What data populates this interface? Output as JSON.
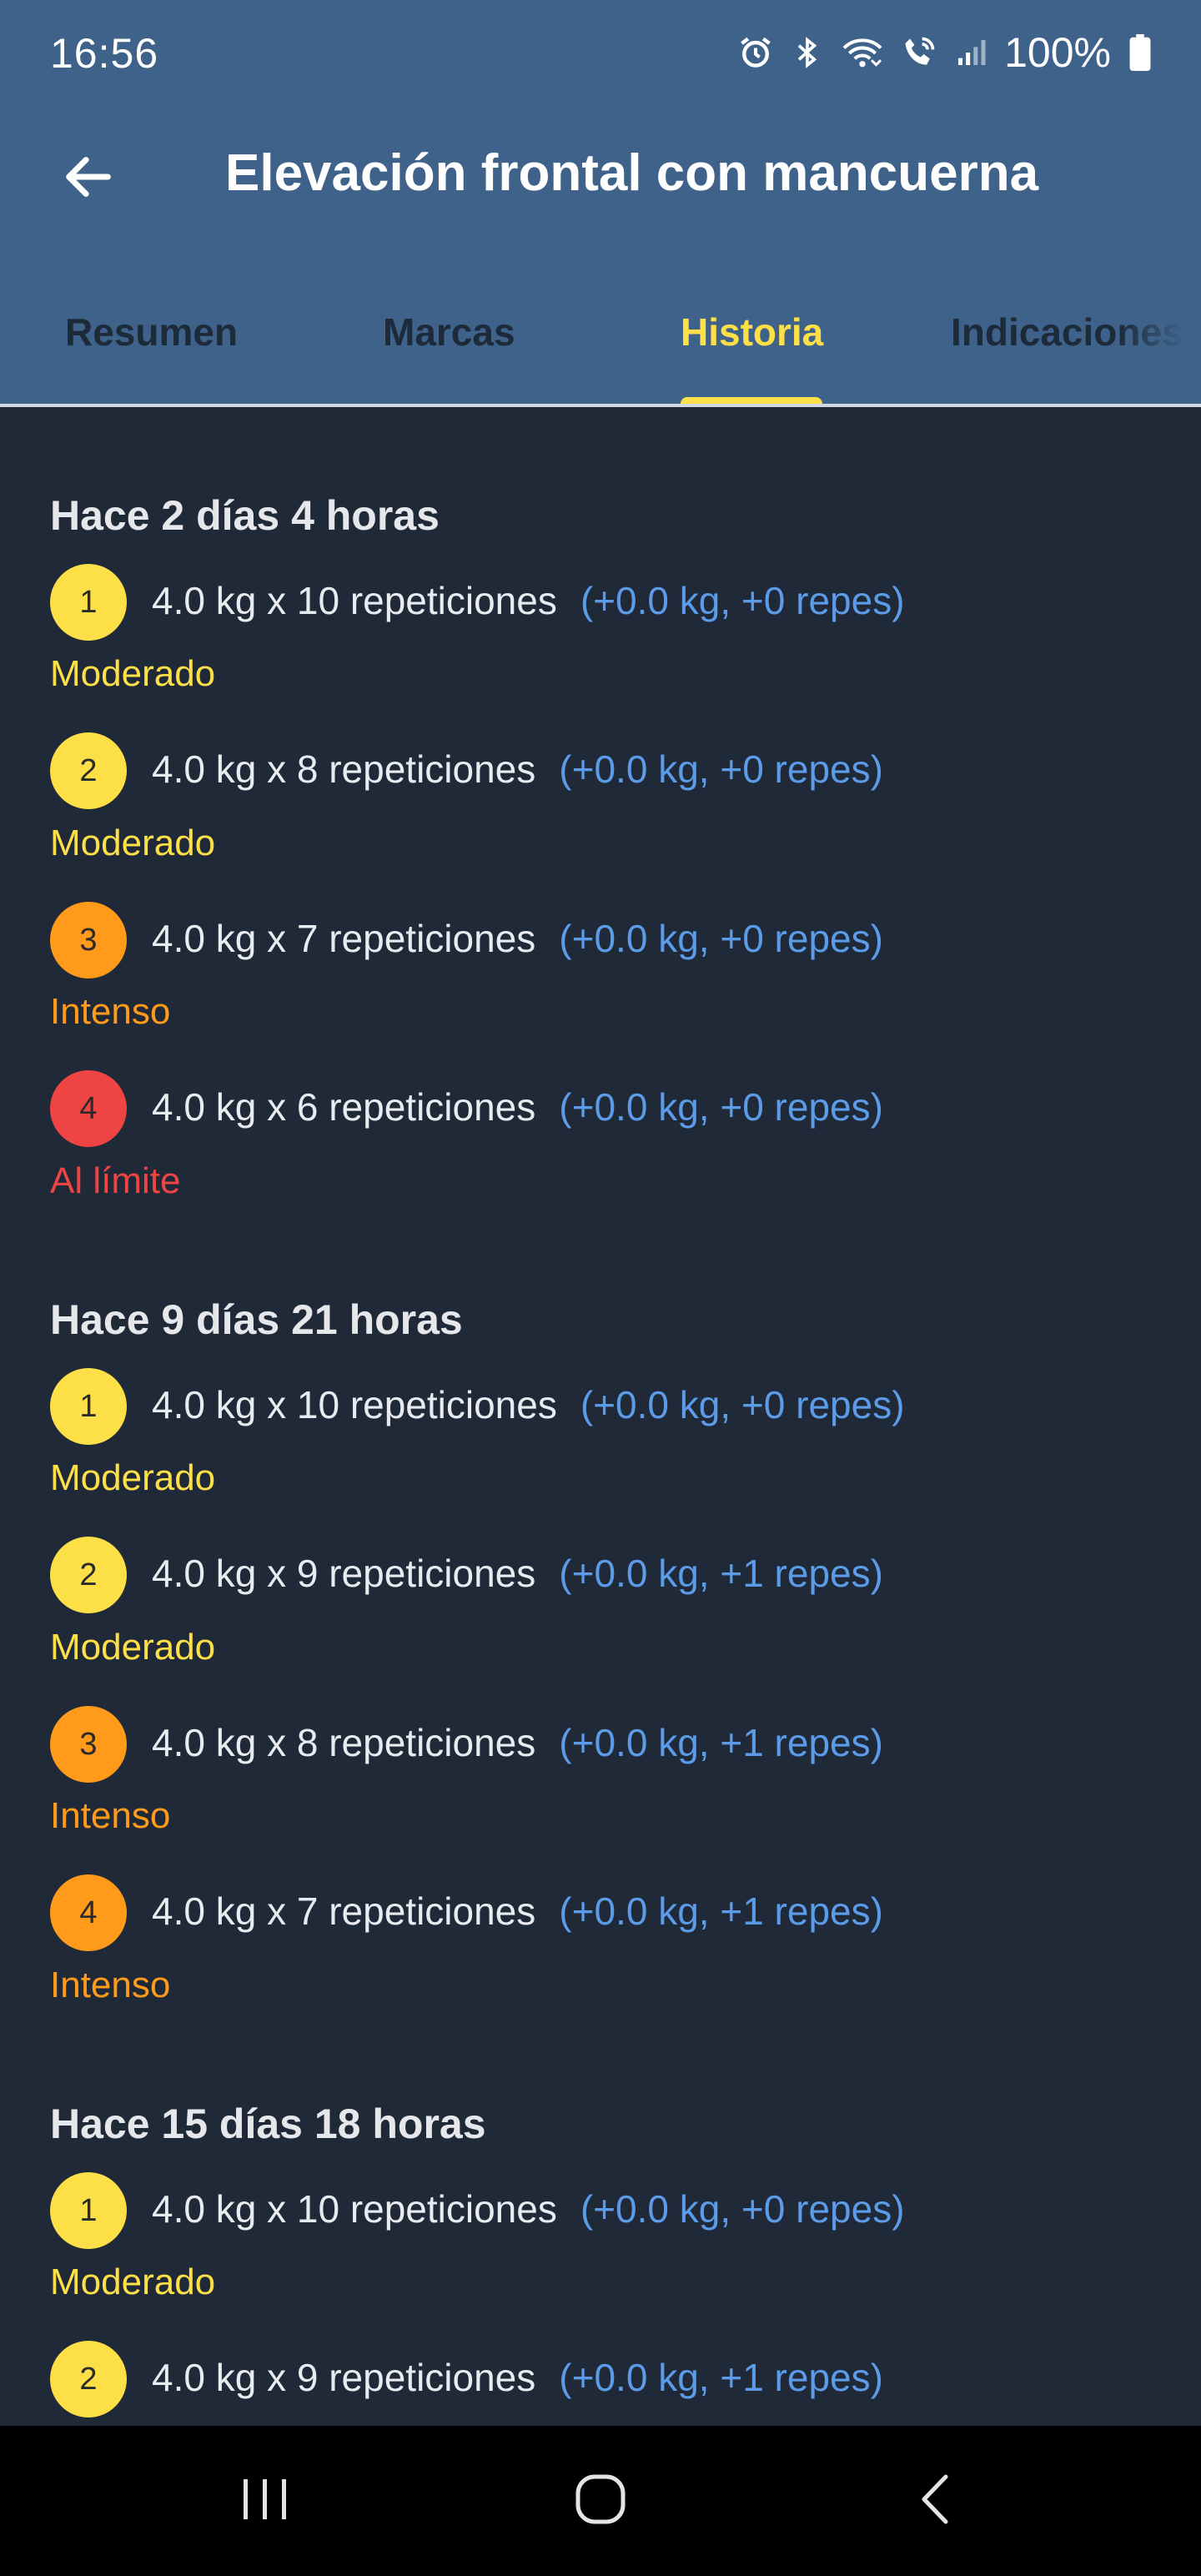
{
  "status_bar": {
    "time": "16:56",
    "battery": "100%",
    "icons": [
      "alarm-icon",
      "bluetooth-icon",
      "wifi-icon",
      "wifi-calling-icon",
      "signal-icon",
      "battery-icon"
    ]
  },
  "app_bar": {
    "title": "Elevación frontal con mancuerna",
    "back_icon": "arrow-back-icon"
  },
  "tabs": [
    {
      "label": "Resumen",
      "active": false
    },
    {
      "label": "Marcas",
      "active": false
    },
    {
      "label": "Historia",
      "active": true
    },
    {
      "label": "Indicaciones",
      "active": false
    }
  ],
  "colors": {
    "header": "#3e6289",
    "background": "#1f2937",
    "accent": "#fde047",
    "moderado": "#fde047",
    "intenso": "#ff9a1a",
    "al_limite": "#ef4444",
    "delta": "#5b9be8"
  },
  "sessions": [
    {
      "title": "Hace 2 días 4 horas",
      "sets": [
        {
          "n": "1",
          "text": "4.0 kg x 10 repeticiones",
          "delta": "(+0.0 kg, +0 repes)",
          "effort": "Moderado",
          "level": "moderado"
        },
        {
          "n": "2",
          "text": "4.0 kg x 8 repeticiones",
          "delta": "(+0.0 kg, +0 repes)",
          "effort": "Moderado",
          "level": "moderado"
        },
        {
          "n": "3",
          "text": "4.0 kg x 7 repeticiones",
          "delta": "(+0.0 kg, +0 repes)",
          "effort": "Intenso",
          "level": "intenso"
        },
        {
          "n": "4",
          "text": "4.0 kg x 6 repeticiones",
          "delta": "(+0.0 kg, +0 repes)",
          "effort": "Al límite",
          "level": "al_limite"
        }
      ]
    },
    {
      "title": "Hace 9 días 21 horas",
      "sets": [
        {
          "n": "1",
          "text": "4.0 kg x 10 repeticiones",
          "delta": "(+0.0 kg, +0 repes)",
          "effort": "Moderado",
          "level": "moderado"
        },
        {
          "n": "2",
          "text": "4.0 kg x 9 repeticiones",
          "delta": "(+0.0 kg, +1 repes)",
          "effort": "Moderado",
          "level": "moderado"
        },
        {
          "n": "3",
          "text": "4.0 kg x 8 repeticiones",
          "delta": "(+0.0 kg, +1 repes)",
          "effort": "Intenso",
          "level": "intenso"
        },
        {
          "n": "4",
          "text": "4.0 kg x 7 repeticiones",
          "delta": "(+0.0 kg, +1 repes)",
          "effort": "Intenso",
          "level": "intenso"
        }
      ]
    },
    {
      "title": "Hace 15 días 18 horas",
      "sets": [
        {
          "n": "1",
          "text": "4.0 kg x 10 repeticiones",
          "delta": "(+0.0 kg, +0 repes)",
          "effort": "Moderado",
          "level": "moderado"
        },
        {
          "n": "2",
          "text": "4.0 kg x 9 repeticiones",
          "delta": "(+0.0 kg, +1 repes)",
          "effort": "",
          "level": "moderado"
        }
      ]
    }
  ],
  "nav_bar": {
    "buttons": [
      "recent-apps-icon",
      "home-icon",
      "back-nav-icon"
    ]
  }
}
